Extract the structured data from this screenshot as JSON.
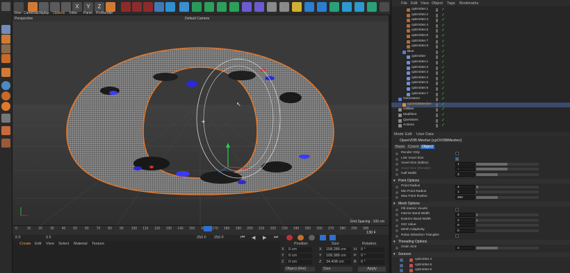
{
  "menu": [
    "View",
    "Cameras",
    "Display",
    "Options",
    "Filter",
    "Panel",
    "ProRender"
  ],
  "toolbar_letters": [
    "X",
    "Y",
    "Z"
  ],
  "viewport": {
    "label_left": "Perspective",
    "label_center": "Default Camera",
    "grid_spacing": "Grid Spacing : 100 cm"
  },
  "timeline": {
    "ticks": [
      "0",
      "10",
      "20",
      "30",
      "40",
      "50",
      "60",
      "70",
      "80",
      "90",
      "100",
      "110",
      "120",
      "130",
      "140",
      "150",
      "160",
      "170",
      "180",
      "190",
      "200",
      "210",
      "220",
      "230",
      "240",
      "250",
      "260",
      "270",
      "280",
      "290",
      "300"
    ],
    "end_frame": "130 F"
  },
  "transport": {
    "start": "0 F",
    "current": "0 F",
    "min": "250 F",
    "max": "250 F"
  },
  "material_menu": [
    "Create",
    "Edit",
    "View",
    "Select",
    "Material",
    "Texture"
  ],
  "coordinates": {
    "headers": [
      "Position",
      "Size",
      "Rotation"
    ],
    "rows": [
      {
        "axis": "X",
        "pos": "0 cm",
        "axis2": "X",
        "size": "158.286 cm",
        "axis3": "H",
        "rot": "0 °"
      },
      {
        "axis": "Y",
        "pos": "0 cm",
        "axis2": "Y",
        "size": "108.386 cm",
        "axis3": "P",
        "rot": "0 °"
      },
      {
        "axis": "Z",
        "pos": "0 cm",
        "axis2": "Z",
        "size": "34.408 cm",
        "axis3": "B",
        "rot": "0 °"
      }
    ],
    "mode_select": "Object (Rel)",
    "size_select": "Size",
    "apply_label": "Apply"
  },
  "object_manager": {
    "menu": [
      "File",
      "Edit",
      "View",
      "Object",
      "Tags",
      "Bookmarks"
    ],
    "items": [
      {
        "name": "cpEmitter.1",
        "indent": 3,
        "color": "#b46b3b"
      },
      {
        "name": "cpEmitter.2",
        "indent": 3,
        "color": "#b46b3b"
      },
      {
        "name": "cpEmitter.3",
        "indent": 3,
        "color": "#b46b3b"
      },
      {
        "name": "cpEmitter.4",
        "indent": 3,
        "color": "#b46b3b"
      },
      {
        "name": "cpEmitter.5",
        "indent": 3,
        "color": "#b46b3b"
      },
      {
        "name": "cpEmitter.6",
        "indent": 3,
        "color": "#b46b3b"
      },
      {
        "name": "cpEmitter.7",
        "indent": 3,
        "color": "#b46b3b"
      },
      {
        "name": "cpEmitter.8",
        "indent": 3,
        "color": "#b46b3b"
      },
      {
        "name": "Blue",
        "indent": 2,
        "color": "#5a7bd6"
      },
      {
        "name": "cpEmitter",
        "indent": 3,
        "color": "#6f8fd6"
      },
      {
        "name": "cpEmitter.1",
        "indent": 3,
        "color": "#6f8fd6"
      },
      {
        "name": "cpEmitter.2",
        "indent": 3,
        "color": "#6f8fd6"
      },
      {
        "name": "cpEmitter.3",
        "indent": 3,
        "color": "#6f8fd6"
      },
      {
        "name": "cpEmitter.4",
        "indent": 3,
        "color": "#6f8fd6"
      },
      {
        "name": "cpEmitter.5",
        "indent": 3,
        "color": "#6f8fd6"
      },
      {
        "name": "cpEmitter.6",
        "indent": 3,
        "color": "#6f8fd6"
      },
      {
        "name": "cpEmitter.7",
        "indent": 3,
        "color": "#6f8fd6"
      },
      {
        "name": "Generators",
        "indent": 1,
        "color": "#5a7bd6"
      },
      {
        "name": "cpOVDBMesher",
        "indent": 2,
        "color": "#e58a2c",
        "selected": true
      },
      {
        "name": "Utilities",
        "indent": 1,
        "color": "#8a8a8a"
      },
      {
        "name": "Modifiers",
        "indent": 1,
        "color": "#8a8a8a"
      },
      {
        "name": "Questions",
        "indent": 1,
        "color": "#8a8a8a"
      },
      {
        "name": "Actions",
        "indent": 1,
        "color": "#8a8a8a"
      }
    ]
  },
  "attributes": {
    "menu": [
      "Mode",
      "Edit",
      "User Data"
    ],
    "title": "OpenVDB Mesher [cpOVDBMesher]",
    "tabs": [
      "Basic",
      "Coord.",
      "Object"
    ],
    "rows": [
      {
        "type": "check",
        "label": "Render Only",
        "checked": false
      },
      {
        "type": "check",
        "label": "Link Voxel Size",
        "checked": true
      },
      {
        "type": "value",
        "label": "Voxel Size (Editor)",
        "value": "1",
        "fill": 0.5
      },
      {
        "type": "value",
        "label": "Voxel Size (Render)",
        "value": "1",
        "fill": 0.5,
        "disabled": true
      },
      {
        "type": "value",
        "label": "Half Width",
        "value": "3",
        "fill": 0.35
      }
    ],
    "sections": [
      {
        "title": "Point Options",
        "rows": [
          {
            "type": "value",
            "label": "Point Radius",
            "value": "3",
            "fill": 0.03
          },
          {
            "type": "value",
            "label": "Min Point Radius",
            "value": "1",
            "fill": 0.01
          },
          {
            "type": "value",
            "label": "Max Point Radius",
            "value": "350",
            "fill": 0.35
          }
        ]
      },
      {
        "title": "Mesh Options",
        "rows": [
          {
            "type": "check",
            "label": "Fill Interior Voxels",
            "checked": false
          },
          {
            "type": "value",
            "label": "Interior Band Width",
            "value": "2",
            "fill": 0.02
          },
          {
            "type": "value",
            "label": "Exterior Band Width",
            "value": "2",
            "fill": 0.02
          },
          {
            "type": "value",
            "label": "ISO Value",
            "value": "0",
            "fill": 0.0
          },
          {
            "type": "value",
            "label": "Mesh Adaptivity",
            "value": "0",
            "fill": 0.0
          },
          {
            "type": "check",
            "label": "Relax Distortion Triangles",
            "checked": false
          }
        ]
      },
      {
        "title": "Threading Options",
        "rows": [
          {
            "type": "value",
            "label": "Grain Size",
            "value": "2",
            "fill": 0.35
          }
        ]
      },
      {
        "title": "Sources",
        "rows": [
          {
            "type": "source",
            "label": "cpEmitter.4"
          },
          {
            "type": "source",
            "label": "cpEmitter.5"
          },
          {
            "type": "source",
            "label": "cpEmitter.6"
          }
        ]
      }
    ]
  }
}
